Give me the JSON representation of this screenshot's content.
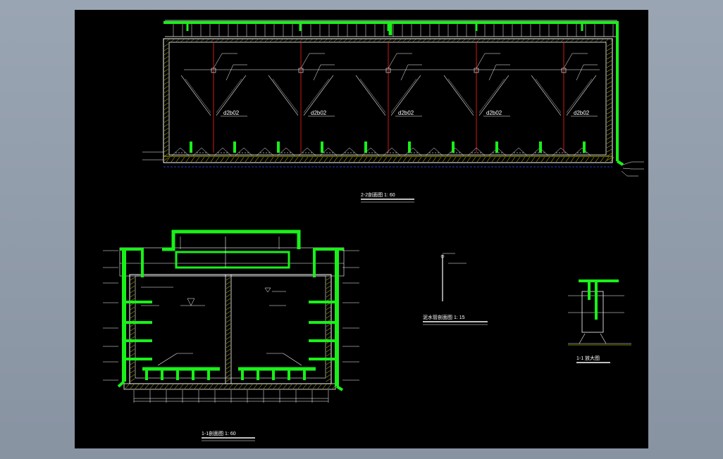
{
  "colors": {
    "background": "#8f9aa8",
    "sheet": "#000000",
    "pipe": "#19f019",
    "line": "#ffffff",
    "hatch": "#e6e600",
    "axis": "#ff2020",
    "dim": "#2a4dff"
  },
  "titles": {
    "section_22": "2-2剖面图 1: 60",
    "section_11": "1-1剖面图 1: 60",
    "detail_mid": "泥水管剖面图 1: 15",
    "detail_right": "1-1 放大图"
  },
  "section_22": {
    "bay_labels": [
      "d2b02",
      "d2b02",
      "d2b02",
      "d2b02",
      "d2b02"
    ]
  }
}
